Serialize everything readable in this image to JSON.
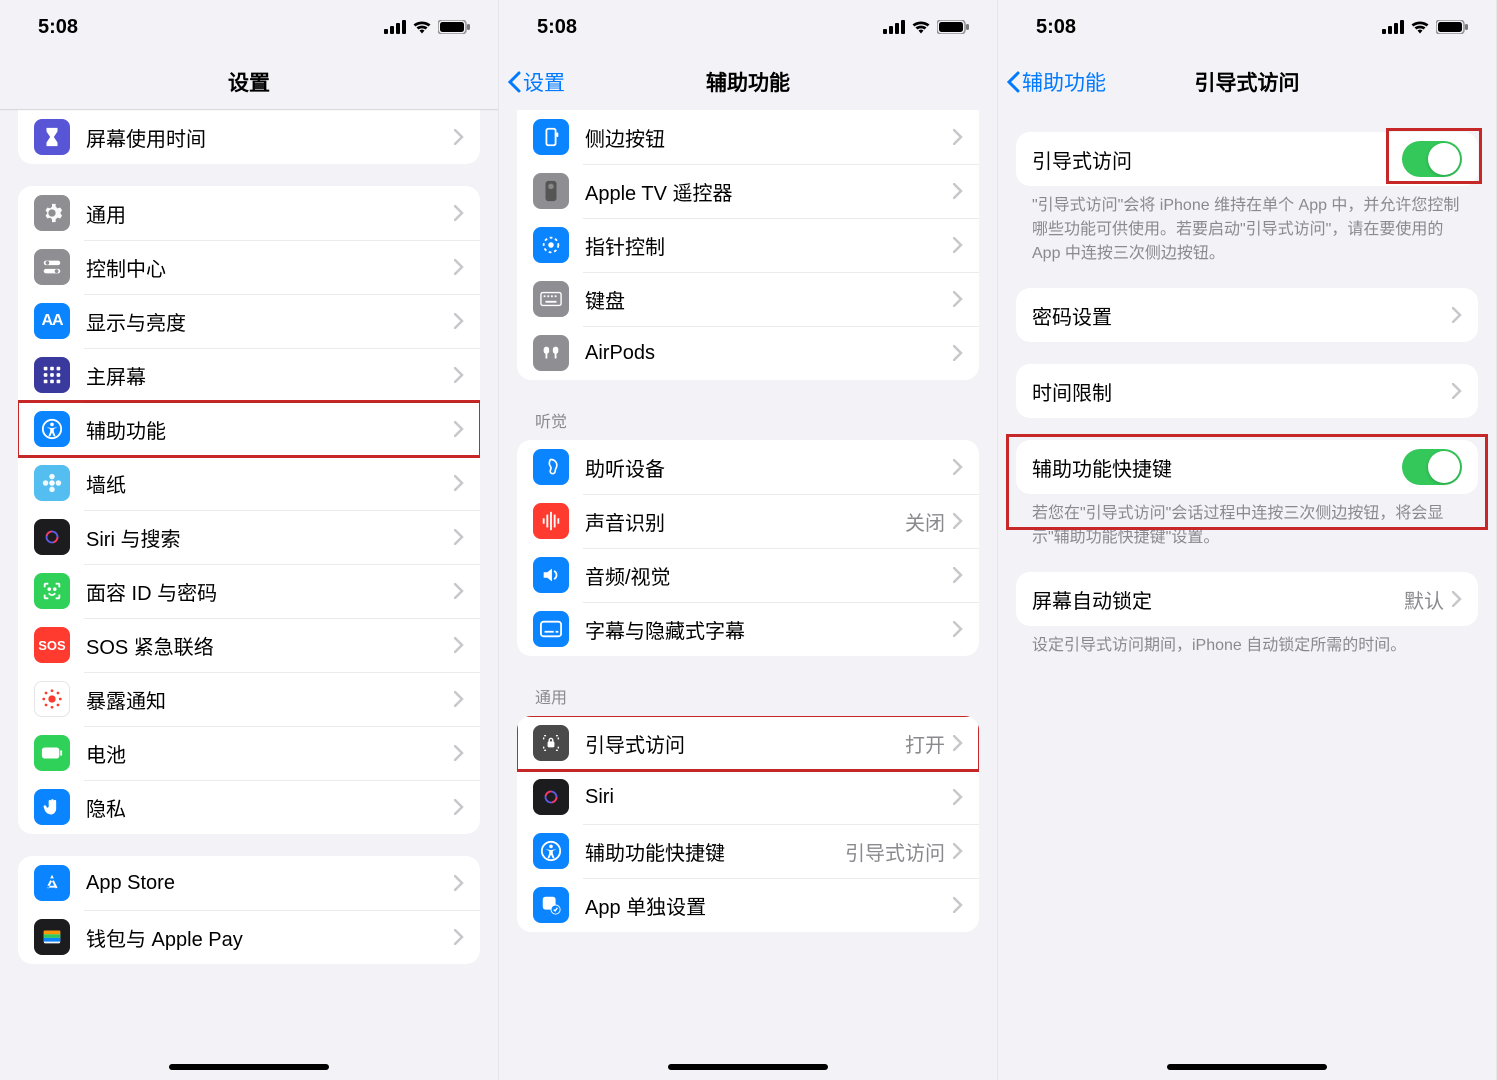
{
  "status": {
    "time": "5:08"
  },
  "phone1": {
    "title": "设置",
    "peek": {
      "label": "屏幕使用时间",
      "icon": "hourglass",
      "color": "#5856d6"
    },
    "group1": [
      {
        "label": "通用",
        "icon": "gear",
        "color": "#8e8e93"
      },
      {
        "label": "控制中心",
        "icon": "switches",
        "color": "#8e8e93"
      },
      {
        "label": "显示与亮度",
        "icon": "AA",
        "color": "#0a84ff"
      },
      {
        "label": "主屏幕",
        "icon": "grid",
        "color": "#3a3a9e"
      },
      {
        "label": "辅助功能",
        "icon": "accessibility",
        "color": "#0a84ff",
        "highlight": true
      },
      {
        "label": "墙纸",
        "icon": "flower",
        "color": "#55bef0"
      },
      {
        "label": "Siri 与搜索",
        "icon": "siri",
        "color": "#1c1c1e"
      },
      {
        "label": "面容 ID 与密码",
        "icon": "faceid",
        "color": "#30d158"
      },
      {
        "label": "SOS 紧急联络",
        "icon": "SOS",
        "color": "#ff3b30"
      },
      {
        "label": "暴露通知",
        "icon": "exposure",
        "color": "#ffffff"
      },
      {
        "label": "电池",
        "icon": "battery",
        "color": "#30d158"
      },
      {
        "label": "隐私",
        "icon": "hand",
        "color": "#0a84ff"
      }
    ],
    "group2": [
      {
        "label": "App Store",
        "icon": "appstore",
        "color": "#0a84ff"
      },
      {
        "label": "钱包与 Apple Pay",
        "icon": "wallet",
        "color": "#1c1c1e"
      }
    ]
  },
  "phone2": {
    "back": "设置",
    "title": "辅助功能",
    "peek": [
      {
        "label": "侧边按钮",
        "icon": "sidebutton",
        "color": "#0a84ff"
      },
      {
        "label": "Apple TV 遥控器",
        "icon": "remote",
        "color": "#8e8e93"
      },
      {
        "label": "指针控制",
        "icon": "pointer",
        "color": "#0a84ff"
      },
      {
        "label": "键盘",
        "icon": "keyboard",
        "color": "#8e8e93"
      },
      {
        "label": "AirPods",
        "icon": "airpods",
        "color": "#8e8e93"
      }
    ],
    "hearing_header": "听觉",
    "hearing": [
      {
        "label": "助听设备",
        "icon": "ear",
        "color": "#0a84ff"
      },
      {
        "label": "声音识别",
        "icon": "waveform",
        "color": "#ff3b30",
        "detail": "关闭"
      },
      {
        "label": "音频/视觉",
        "icon": "audio",
        "color": "#0a84ff"
      },
      {
        "label": "字幕与隐藏式字幕",
        "icon": "subtitles",
        "color": "#0a84ff"
      }
    ],
    "general_header": "通用",
    "general": [
      {
        "label": "引导式访问",
        "icon": "lock-frame",
        "color": "#4a4a4a",
        "detail": "打开",
        "highlight": true
      },
      {
        "label": "Siri",
        "icon": "siri",
        "color": "#1c1c1e"
      },
      {
        "label": "辅助功能快捷键",
        "icon": "accessibility",
        "color": "#0a84ff",
        "detail": "引导式访问"
      },
      {
        "label": "App 单独设置",
        "icon": "app-settings",
        "color": "#0a84ff"
      }
    ]
  },
  "phone3": {
    "back": "辅助功能",
    "title": "引导式访问",
    "toggle1": {
      "label": "引导式访问",
      "on": true,
      "highlight": true
    },
    "footer1": "\"引导式访问\"会将 iPhone 维持在单个 App 中，并允许您控制哪些功能可供使用。若要启动\"引导式访问\"，请在要使用的 App 中连按三次侧边按钮。",
    "row_password": {
      "label": "密码设置"
    },
    "row_time": {
      "label": "时间限制"
    },
    "toggle2": {
      "label": "辅助功能快捷键",
      "on": true,
      "highlight_group": true
    },
    "footer2": "若您在\"引导式访问\"会话过程中连按三次侧边按钮，将会显示\"辅助功能快捷键\"设置。",
    "row_lock": {
      "label": "屏幕自动锁定",
      "detail": "默认"
    },
    "footer3": "设定引导式访问期间，iPhone 自动锁定所需的时间。"
  }
}
